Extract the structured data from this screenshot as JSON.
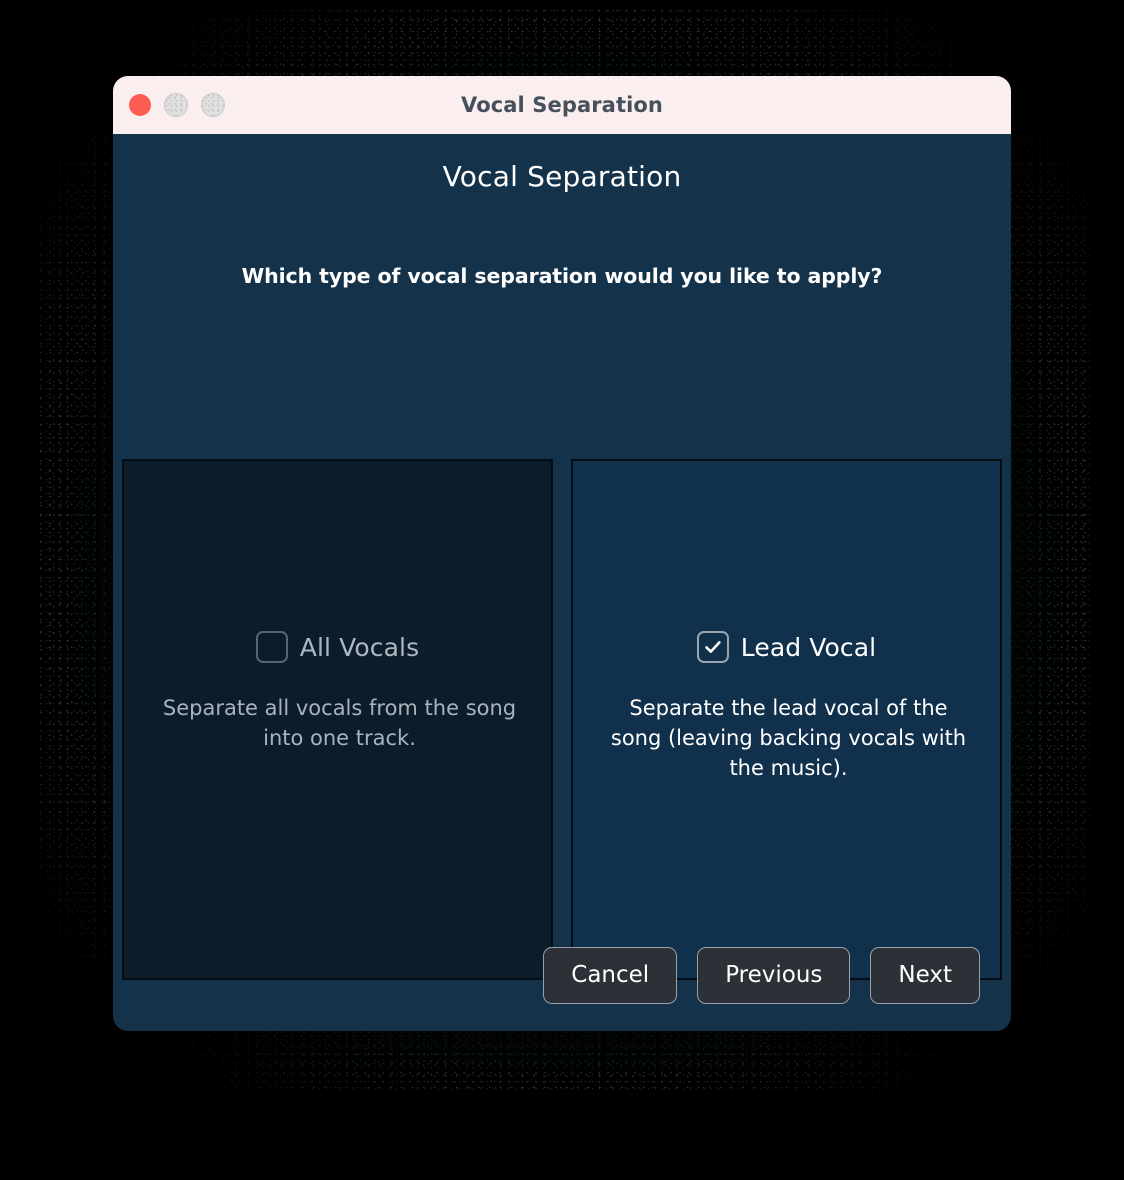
{
  "window": {
    "title": "Vocal Separation",
    "traffic_lights": [
      {
        "name": "close",
        "color": "#fd5c52"
      },
      {
        "name": "minimize",
        "color": "#e0e0e0"
      },
      {
        "name": "zoom",
        "color": "#e0e0e0"
      }
    ]
  },
  "dialog": {
    "heading": "Vocal Separation",
    "question": "Which type of vocal separation would you like to apply?",
    "background_color": "#14324a"
  },
  "options": [
    {
      "id": "all-vocals",
      "label": "All Vocals",
      "description": "Separate all vocals from the song into one track.",
      "checked": false,
      "panel_color": "#0b1c2a"
    },
    {
      "id": "lead-vocal",
      "label": "Lead Vocal",
      "description": "Separate the lead vocal of the song (leaving backing vocals with the music).",
      "checked": true,
      "panel_color": "#11304c"
    }
  ],
  "footer": {
    "cancel_label": "Cancel",
    "previous_label": "Previous",
    "next_label": "Next"
  }
}
